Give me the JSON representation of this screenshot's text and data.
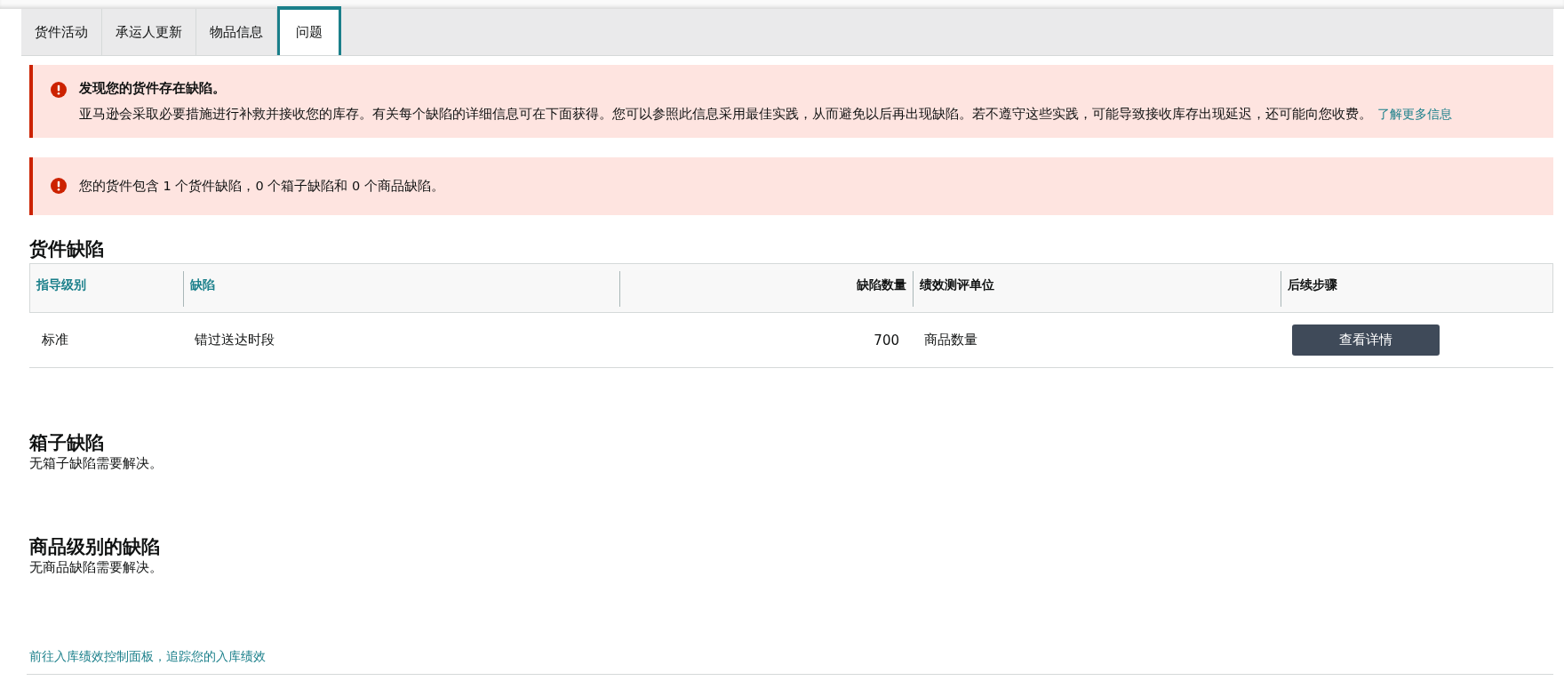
{
  "tabs": [
    {
      "label": "货件活动",
      "selected": false
    },
    {
      "label": "承运人更新",
      "selected": false
    },
    {
      "label": "物品信息",
      "selected": false
    },
    {
      "label": "问题",
      "selected": true
    }
  ],
  "alerts": [
    {
      "title": "发现您的货件存在缺陷。",
      "message": "亚马逊会采取必要措施进行补救并接收您的库存。有关每个缺陷的详细信息可在下面获得。您可以参照此信息采用最佳实践，从而避免以后再出现缺陷。若不遵守这些实践，可能导致接收库存出现延迟，还可能向您收费。",
      "link": "了解更多信息"
    },
    {
      "message": "您的货件包含 1 个货件缺陷，0 个箱子缺陷和 0 个商品缺陷。"
    }
  ],
  "shipment_defects": {
    "heading": "货件缺陷",
    "columns": [
      {
        "label": "指导级别",
        "sortable": true,
        "numeric": false
      },
      {
        "label": "缺陷",
        "sortable": true,
        "numeric": false
      },
      {
        "label": "缺陷数量",
        "sortable": false,
        "numeric": true
      },
      {
        "label": "绩效测评单位",
        "sortable": false,
        "numeric": false
      },
      {
        "label": "后续步骤",
        "sortable": false,
        "numeric": false
      }
    ],
    "rows": [
      {
        "level": "标准",
        "defect": "错过送达时段",
        "count": "700",
        "unit": "商品数量",
        "action": "查看详情"
      }
    ]
  },
  "box_defects": {
    "heading": "箱子缺陷",
    "message": "无箱子缺陷需要解决。"
  },
  "item_defects": {
    "heading": "商品级别的缺陷",
    "message": "无商品缺陷需要解决。"
  },
  "footer_link": "前往入库绩效控制面板，追踪您的入库绩效"
}
